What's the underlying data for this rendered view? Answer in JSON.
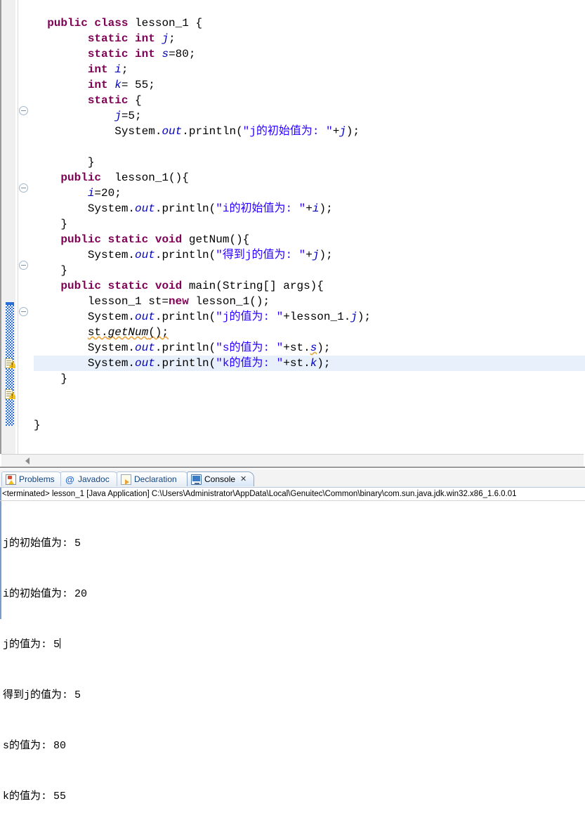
{
  "editor": {
    "name": "java-editor",
    "language": "java",
    "class_name": "lesson_1",
    "current_line_index": 23,
    "code_lines": [
      "",
      "public class lesson_1 {",
      "      static int j;",
      "      static int s=80;",
      "      int i;",
      "      int k= 55;",
      "      static {",
      "          j=5;",
      "          System.out.println(\"j的初始值为: \"+j);",
      "",
      "      }",
      "    public  lesson_1(){",
      "        i=20;",
      "        System.out.println(\"i的初始值为: \"+i);",
      "    }",
      "    public static void getNum(){",
      "        System.out.println(\"得到j的值为: \"+j);",
      "    }",
      "    public static void main(String[] args){",
      "        lesson_1 st=new lesson_1();",
      "        System.out.println(\"j的值为: \"+lesson_1.j);",
      "        st.getNum();",
      "        System.out.println(\"s的值为: \"+st.s);",
      "        System.out.println(\"k的值为: \"+st.k);",
      "    }",
      "",
      "",
      "}"
    ],
    "string_literals": [
      "\"j的初始值为: \"",
      "\"i的初始值为: \"",
      "\"得到j的值为: \"",
      "\"j的值为: \"",
      "\"s的值为: \"",
      "\"k的值为: \""
    ],
    "keywords": [
      "public",
      "class",
      "static",
      "int",
      "void",
      "new"
    ],
    "warning_markers": 2,
    "fold_markers": 4,
    "colors": {
      "keyword": "#7f0055",
      "string": "#2a00ff",
      "field": "#0000c0",
      "current_line_highlight": "#e8f0fb",
      "change_bar": "#2a6fd6",
      "warning": "#f0c020"
    }
  },
  "bottom_view": {
    "tabs": [
      {
        "label": "Problems",
        "icon": "problems-icon",
        "active": false
      },
      {
        "label": "Javadoc",
        "icon": "at-icon",
        "active": false
      },
      {
        "label": "Declaration",
        "icon": "declaration-icon",
        "active": false
      },
      {
        "label": "Console",
        "icon": "console-icon",
        "active": true,
        "close": "✕"
      }
    ],
    "console": {
      "terminated_line": "<terminated> lesson_1 [Java Application] C:\\Users\\Administrator\\AppData\\Local\\Genuitec\\Common\\binary\\com.sun.java.jdk.win32.x86_1.6.0.01",
      "output_lines": [
        "j的初始值为: 5",
        "i的初始值为: 20",
        "j的值为: 5",
        "得到j的值为: 5",
        "s的值为: 80",
        "k的值为: 55"
      ],
      "caret_line_index": 2
    }
  }
}
